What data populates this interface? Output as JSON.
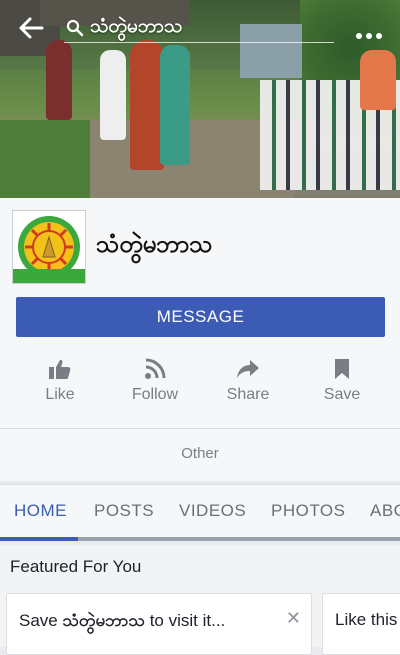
{
  "header": {
    "search_value": "သံတွဲမဘာသ"
  },
  "page": {
    "name": "သံတွဲမဘာသ",
    "message_label": "MESSAGE",
    "actions": [
      {
        "label": "Like",
        "icon": "thumbs-up-icon"
      },
      {
        "label": "Follow",
        "icon": "rss-icon"
      },
      {
        "label": "Share",
        "icon": "share-arrow-icon"
      },
      {
        "label": "Save",
        "icon": "bookmark-icon"
      }
    ],
    "other_label": "Other"
  },
  "tabs": [
    {
      "label": "HOME",
      "active": true
    },
    {
      "label": "POSTS",
      "active": false
    },
    {
      "label": "VIDEOS",
      "active": false
    },
    {
      "label": "PHOTOS",
      "active": false
    },
    {
      "label": "ABO",
      "active": false
    }
  ],
  "featured": {
    "title": "Featured For You",
    "cards": [
      {
        "prefix": "Save ",
        "bold": "သံတွဲမဘာသ",
        "suffix": " to visit it..."
      },
      {
        "text": "Like this"
      }
    ]
  },
  "colors": {
    "accent": "#3b5bb5",
    "background": "#e9ebee",
    "muted_text": "#7a7e84"
  }
}
